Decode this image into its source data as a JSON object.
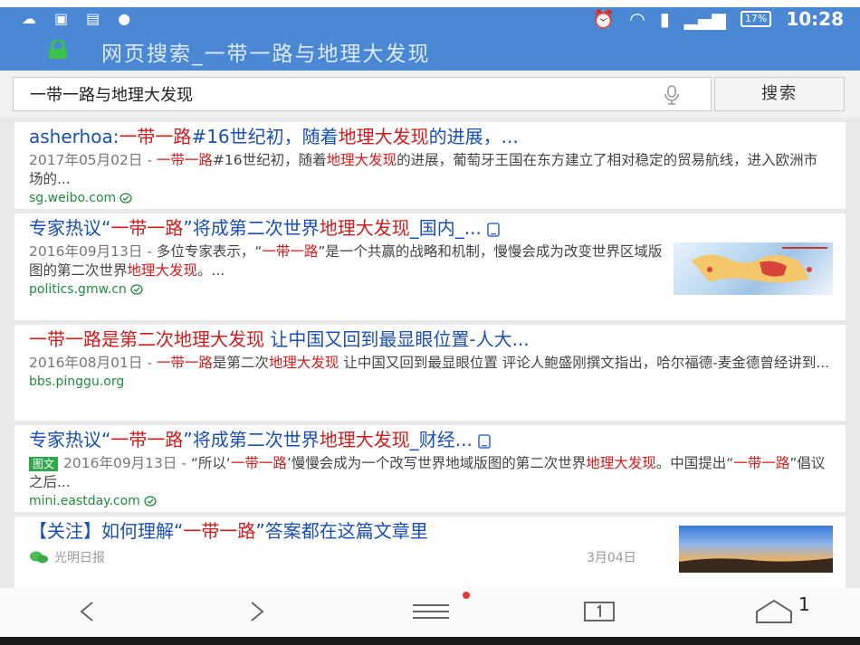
{
  "status_bar": {
    "time": "10:28",
    "battery": "17%"
  },
  "page_title": "网页搜索_一带一路与地理大发现",
  "search": {
    "query": "一带一路与地理大发现",
    "button_label": "搜索"
  },
  "results": [
    {
      "title_parts": [
        [
          "asherhoa:",
          false
        ],
        [
          "一带一路",
          true
        ],
        [
          "#16世纪初，随着",
          false
        ],
        [
          "地理大发现",
          true
        ],
        [
          "的进展，...",
          false
        ]
      ],
      "date": "2017年05月02日 - ",
      "snippet_parts": [
        [
          "一带一路",
          true
        ],
        [
          "#16世纪初，随着",
          false
        ],
        [
          "地理大发现",
          true
        ],
        [
          "的进展，葡萄牙王国在东方建立了相对稳定的贸易航线，进入欧洲市场的...",
          false
        ]
      ],
      "url": "sg.weibo.com"
    },
    {
      "title_parts": [
        [
          "专家热议“",
          false
        ],
        [
          "一带一路",
          true
        ],
        [
          "”将成第二次世界",
          false
        ],
        [
          "地理大发现",
          true
        ],
        [
          "_国内_...",
          false
        ]
      ],
      "date": "2016年09月13日 - ",
      "snippet_parts": [
        [
          "多位专家表示，“",
          false
        ],
        [
          "一带一路",
          true
        ],
        [
          "”是一个共赢的战略和机制，慢慢会成为改变世界区域版图的第二次世界",
          false
        ],
        [
          "地理大发现",
          true
        ],
        [
          "。...",
          false
        ]
      ],
      "url": "politics.gmw.cn"
    },
    {
      "title_parts": [
        [
          "一带一路",
          true
        ],
        [
          "是第二次",
          true
        ],
        [
          "地理大发现",
          true
        ],
        [
          " 让中国又回到最显眼位置-人大...",
          false
        ]
      ],
      "date": "2016年08月01日 - ",
      "snippet_parts": [
        [
          "一带一路",
          true
        ],
        [
          "是第二次",
          false
        ],
        [
          "地理大发现",
          true
        ],
        [
          " 让中国又回到最显眼位置 评论人鲍盛刚撰文指出，哈尔福德-麦金德曾经讲到...",
          false
        ]
      ],
      "url": "bbs.pinggu.org"
    },
    {
      "title_parts": [
        [
          "专家热议“",
          false
        ],
        [
          "一带一路",
          true
        ],
        [
          "”将成第二次世界",
          false
        ],
        [
          "地理大发现",
          true
        ],
        [
          "_财经...",
          false
        ]
      ],
      "badge": "图文",
      "date": "2016年09月13日 - ",
      "snippet_parts": [
        [
          "“所以‘",
          false
        ],
        [
          "一带一路",
          true
        ],
        [
          "’慢慢会成为一个改写世界地域版图的第二次世界",
          false
        ],
        [
          "地理大发现",
          true
        ],
        [
          "。中国提出“",
          false
        ],
        [
          "一带一路",
          true
        ],
        [
          "”倡议之后...",
          false
        ]
      ],
      "url": "mini.eastday.com"
    },
    {
      "title_parts": [
        [
          "【关注】如何理解“",
          false
        ],
        [
          "一带一路",
          true
        ],
        [
          "”答案都在这篇文章里",
          false
        ]
      ],
      "source": "光明日报",
      "date": "3月04日"
    }
  ],
  "slide_number": "1"
}
